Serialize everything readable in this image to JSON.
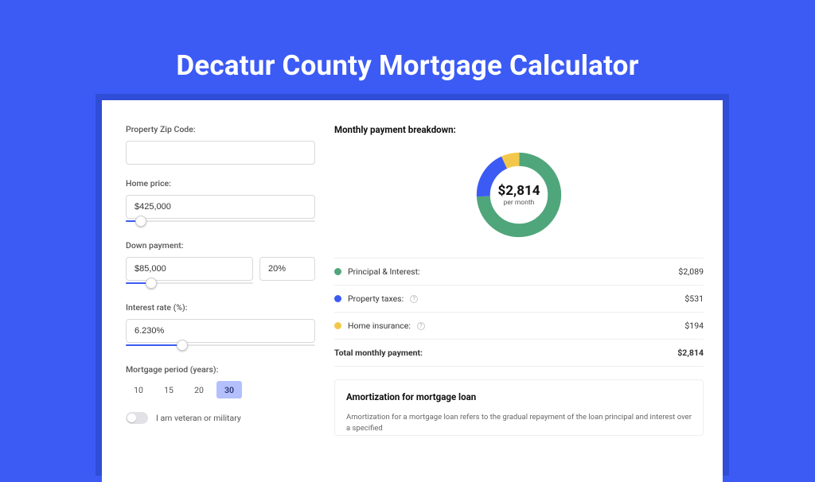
{
  "title": "Decatur County Mortgage Calculator",
  "form": {
    "zip": {
      "label": "Property Zip Code:",
      "value": ""
    },
    "home_price": {
      "label": "Home price:",
      "value": "$425,000",
      "slider_pct": 8
    },
    "down_payment": {
      "label": "Down payment:",
      "amount": "$85,000",
      "percent": "20%",
      "slider_pct": 20
    },
    "interest_rate": {
      "label": "Interest rate (%):",
      "value": "6.230%",
      "slider_pct": 30
    },
    "period": {
      "label": "Mortgage period (years):",
      "options": [
        "10",
        "15",
        "20",
        "30"
      ],
      "selected": "30"
    },
    "veteran": {
      "label": "I am veteran or military",
      "on": false
    }
  },
  "breakdown": {
    "title": "Monthly payment breakdown:",
    "center_amount": "$2,814",
    "center_sub": "per month",
    "items": [
      {
        "label": "Principal & Interest:",
        "value": "$2,089",
        "color": "#4fa67a",
        "info": false
      },
      {
        "label": "Property taxes:",
        "value": "$531",
        "color": "#3c5bf5",
        "info": true
      },
      {
        "label": "Home insurance:",
        "value": "$194",
        "color": "#f3c84a",
        "info": true
      }
    ],
    "total": {
      "label": "Total monthly payment:",
      "value": "$2,814"
    }
  },
  "amort": {
    "title": "Amortization for mortgage loan",
    "text": "Amortization for a mortgage loan refers to the gradual repayment of the loan principal and interest over a specified"
  },
  "chart_data": {
    "type": "pie",
    "title": "Monthly payment breakdown",
    "categories": [
      "Principal & Interest",
      "Property taxes",
      "Home insurance"
    ],
    "values": [
      2089,
      531,
      194
    ],
    "colors": [
      "#4fa67a",
      "#3c5bf5",
      "#f3c84a"
    ],
    "total": 2814
  }
}
